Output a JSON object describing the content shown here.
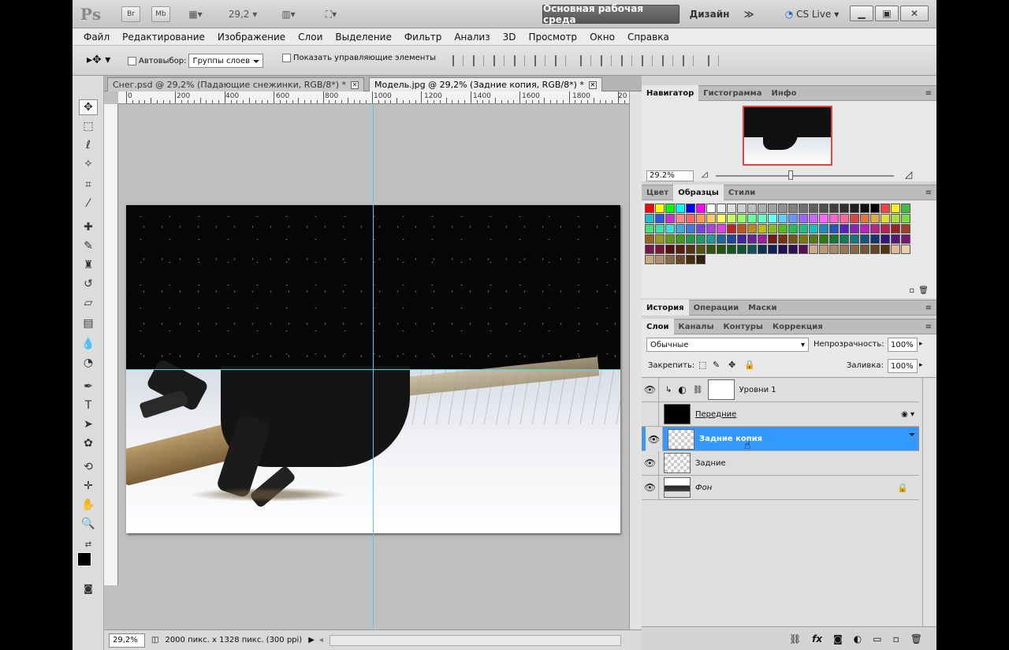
{
  "titlebar": {
    "app_logo": "Ps",
    "bridge_btn": "Br",
    "minibridge_btn": "Mb",
    "zoom_value": "29,2",
    "workspace_button": "Основная рабочая среда",
    "workspace_design": "Дизайн",
    "overflow_glyph": "≫",
    "cs_live": "CS Live"
  },
  "menu": [
    "Файл",
    "Редактирование",
    "Изображение",
    "Слои",
    "Выделение",
    "Фильтр",
    "Анализ",
    "3D",
    "Просмотр",
    "Окно",
    "Справка"
  ],
  "options": {
    "autoselect_label": "Автовыбор:",
    "autoselect_value": "Группы слоев",
    "show_controls_label": "Показать управляющие элементы"
  },
  "tabs": [
    {
      "label": "Снег.psd @ 29,2% (Падающие снежинки, RGB/8*) *",
      "active": false
    },
    {
      "label": "Модель.jpg @ 29,2% (Задние копия, RGB/8*) *",
      "active": true
    }
  ],
  "ruler_labels": [
    "0",
    "200",
    "400",
    "600",
    "800",
    "1000",
    "1200",
    "1400",
    "1600",
    "1800",
    "20"
  ],
  "status": {
    "zoom": "29,2%",
    "doc_info": "2000 пикс. x 1328 пикс. (300 ppi)"
  },
  "navigator": {
    "tabs": [
      "Навигатор",
      "Гистограмма",
      "Инфо"
    ],
    "zoom": "29.2%"
  },
  "swatches_panel": {
    "tabs": [
      "Цвет",
      "Образцы",
      "Стили"
    ]
  },
  "swatch_colors": [
    "#ff0000",
    "#ffff00",
    "#00ff00",
    "#00ffff",
    "#0000ff",
    "#ff00ff",
    "#ffffff",
    "#f0f0f0",
    "#e0e0e0",
    "#d0d0d0",
    "#c0c0c0",
    "#b0b0b0",
    "#a0a0a0",
    "#909090",
    "#808080",
    "#707070",
    "#606060",
    "#505050",
    "#404040",
    "#303030",
    "#202020",
    "#101010",
    "#000000",
    "#ee4444",
    "#ffee22",
    "#44bb44",
    "#22bbcc",
    "#3355dd",
    "#cc33cc",
    "#ff8888",
    "#ff6666",
    "#ff9966",
    "#ffcc66",
    "#ffff66",
    "#ccff66",
    "#99ff66",
    "#66ff99",
    "#66ffcc",
    "#66ffff",
    "#66ccff",
    "#6699ff",
    "#9966ff",
    "#cc66ff",
    "#ff66ff",
    "#ff66cc",
    "#ff6699",
    "#dd4444",
    "#dd7744",
    "#ddaa44",
    "#dddd44",
    "#aadd44",
    "#77dd44",
    "#44dd77",
    "#44ddaa",
    "#44dddd",
    "#44aadd",
    "#4477dd",
    "#7744dd",
    "#aa44dd",
    "#dd44dd",
    "#bb2222",
    "#bb5522",
    "#bb8822",
    "#bbbb22",
    "#88bb22",
    "#55bb22",
    "#22bb55",
    "#22bb88",
    "#22bbbb",
    "#2288bb",
    "#2255bb",
    "#5522bb",
    "#8822bb",
    "#bb22bb",
    "#bb2288",
    "#bb2255",
    "#992222",
    "#994422",
    "#996622",
    "#999922",
    "#669922",
    "#449922",
    "#229944",
    "#229966",
    "#229999",
    "#226699",
    "#224499",
    "#442299",
    "#662299",
    "#992299",
    "#771818",
    "#773318",
    "#775518",
    "#777718",
    "#557718",
    "#337718",
    "#187733",
    "#187755",
    "#187777",
    "#185577",
    "#183377",
    "#331877",
    "#551877",
    "#771877",
    "#771855",
    "#771833",
    "#551010",
    "#552210",
    "#553310",
    "#555510",
    "#335510",
    "#225510",
    "#105522",
    "#105533",
    "#105555",
    "#103355",
    "#102255",
    "#221055",
    "#331055",
    "#551055",
    "#ccaa88",
    "#bb9977",
    "#aa8866",
    "#997755",
    "#886644",
    "#775533",
    "#664422",
    "#553311",
    "#ddbb99",
    "#eeccaa",
    "#c8a880",
    "#b09070",
    "#8a6a4a",
    "#6a4a2a",
    "#4a2a0a",
    "#302010"
  ],
  "history_panel": {
    "tabs": [
      "История",
      "Операции",
      "Маски"
    ]
  },
  "layers_panel": {
    "tabs": [
      "Слои",
      "Каналы",
      "Контуры",
      "Коррекция"
    ],
    "blend_mode": "Обычные",
    "opacity_label": "Непрозрачность:",
    "opacity_value": "100%",
    "lock_label": "Закрепить:",
    "fill_label": "Заливка:",
    "fill_value": "100%",
    "layers": [
      {
        "name": "Уровни 1",
        "visible": true,
        "selected": false
      },
      {
        "name": "Передние",
        "visible": false,
        "selected": false
      },
      {
        "name": "Задние копия",
        "visible": true,
        "selected": true
      },
      {
        "name": "Задние",
        "visible": true,
        "selected": false
      },
      {
        "name": "Фон",
        "visible": true,
        "selected": false
      }
    ]
  },
  "colors": {
    "selection": "#3399ff",
    "guide": "#4fd3e0",
    "navigator_frame": "#dd4444"
  }
}
